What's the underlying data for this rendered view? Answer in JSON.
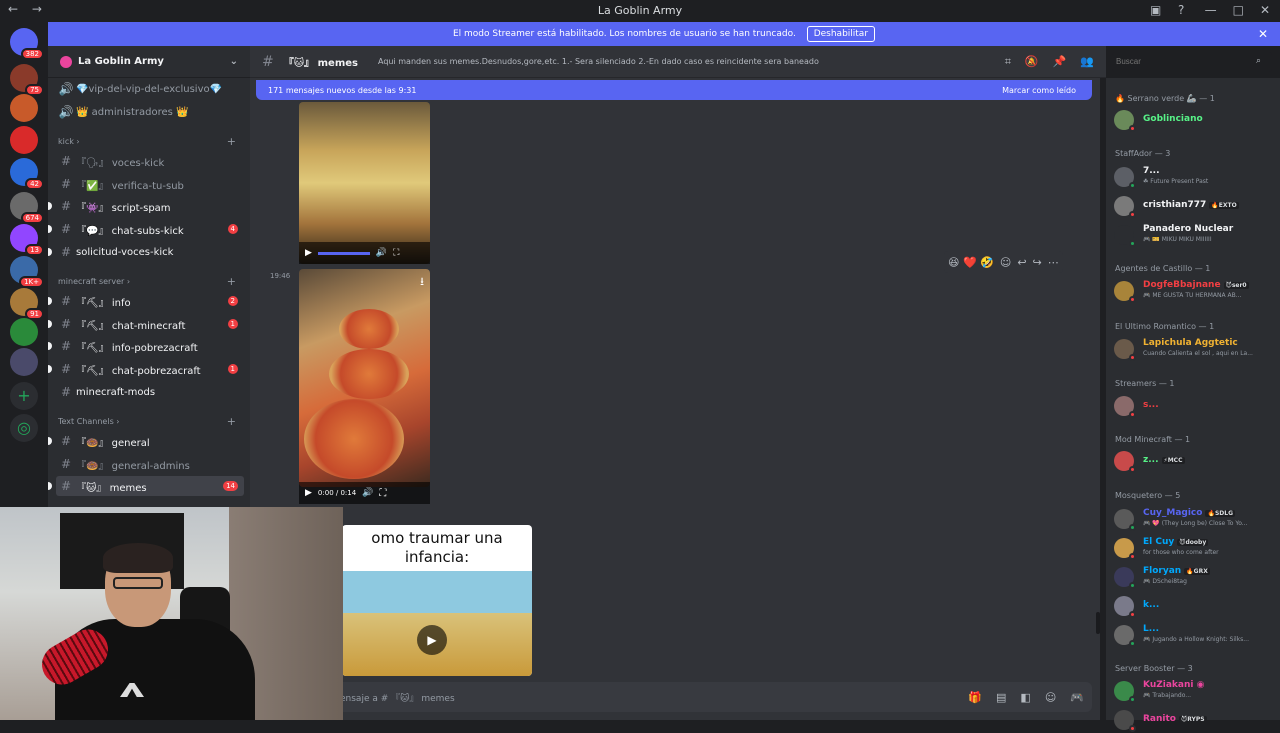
{
  "window": {
    "title": "La Goblin Army"
  },
  "notice": {
    "text": "El modo Streamer está habilitado. Los nombres de usuario se han truncado.",
    "button": "Deshabilitar"
  },
  "servers": [
    {
      "badge": "382"
    },
    {
      "badge": "75"
    },
    {
      "badge": ""
    },
    {
      "badge": ""
    },
    {
      "badge": "42"
    },
    {
      "badge": "674"
    },
    {
      "badge": "13"
    },
    {
      "badge": "1K+"
    },
    {
      "badge": "91"
    },
    {
      "badge": ""
    },
    {
      "badge": ""
    }
  ],
  "guild": {
    "name": "La Goblin Army"
  },
  "channels": {
    "top": [
      {
        "name": "💎vip-del-vip-del-exclusivo💎"
      },
      {
        "name": "👑 administradores 👑"
      }
    ],
    "cat_kick": "kick",
    "kick": [
      {
        "name": "『🗣』 voces-kick",
        "count": ""
      },
      {
        "name": "『✅』 verifica-tu-sub",
        "count": ""
      },
      {
        "name": "『👾』 script-spam",
        "count": ""
      },
      {
        "name": "『💬』 chat-subs-kick",
        "count": "4"
      },
      {
        "name": "solicitud-voces-kick",
        "count": ""
      }
    ],
    "cat_mc": "minecraft server",
    "mc": [
      {
        "name": "『⛏』 info",
        "count": "2"
      },
      {
        "name": "『⛏』 chat-minecraft",
        "count": "1"
      },
      {
        "name": "『⛏』 info-pobrezacraft",
        "count": ""
      },
      {
        "name": "『⛏』 chat-pobrezacraft",
        "count": "1"
      },
      {
        "name": "minecraft-mods",
        "count": ""
      }
    ],
    "cat_text": "Text Channels",
    "text": [
      {
        "name": "『🍩』 general",
        "count": ""
      },
      {
        "name": "『🍩』 general-admins",
        "count": ""
      },
      {
        "name": "『🐱』 memes",
        "count": "14"
      }
    ]
  },
  "header": {
    "channel": "『🐱』 memes",
    "topic": "Aqui manden sus memes.Desnudos,gore,etc. 1.- Sera silenciado 2.-En dado caso es reincidente sera baneado",
    "search_placeholder": "Buscar"
  },
  "newbar": {
    "text": "171 mensajes nuevos desde las 9:31",
    "mark": "Marcar como leído"
  },
  "messages": {
    "time": "19:46",
    "video_time": "0:00 / 0:14",
    "meme_caption": "omo traumar una infancia:",
    "reactions": "😆 ❤️ 🤣"
  },
  "composer": {
    "placeholder": "ensaje a # 『🐱』 memes"
  },
  "members": {
    "groups": [
      {
        "label": "🔥 Serrano verde 🦾 — 1"
      },
      {
        "label": "StaffAdor — 3"
      },
      {
        "label": "Agentes de Castillo — 1"
      },
      {
        "label": "El Ultimo Romantico — 1"
      },
      {
        "label": "Streamers — 1"
      },
      {
        "label": "Mod Minecraft — 1"
      },
      {
        "label": "Mosquetero — 5"
      },
      {
        "label": "Server Booster — 3"
      }
    ],
    "list": [
      {
        "name": "Goblinciano",
        "tag": "",
        "sub": "",
        "color": "#57f287"
      },
      {
        "name": "7...",
        "tag": "",
        "sub": "☘ Future Present Past",
        "color": "#f2f3f5"
      },
      {
        "name": "cristhian777",
        "tag": "🔥EXTO",
        "sub": "",
        "color": "#f2f3f5"
      },
      {
        "name": "Panadero Nuclear",
        "tag": "",
        "sub": "🎮 🎫 MIKU MIKU MIIIIII",
        "color": "#f2f3f5"
      },
      {
        "name": "DogfeBbajnane",
        "tag": "😈ser0",
        "sub": "🎮 ME GUSTA TU HERMANA AB...",
        "color": "#f23f43"
      },
      {
        "name": "Lapichula Aggtetic",
        "tag": "",
        "sub": "Cuando Calienta el sol , aqui en La...",
        "color": "#f0b232"
      },
      {
        "name": "s...",
        "tag": "",
        "sub": "",
        "color": "#f23f43"
      },
      {
        "name": "z...",
        "tag": "⚡MCC",
        "sub": "",
        "color": "#57f287"
      },
      {
        "name": "Cuy_Magico",
        "tag": "🔥SDLG",
        "sub": "🎮 💖 (They Long be) Close To Yo...",
        "color": "#5865f2"
      },
      {
        "name": "El Cuy",
        "tag": "😈dooby",
        "sub": "for those who come after",
        "color": "#00a8fc"
      },
      {
        "name": "Floryan",
        "tag": "🔥GRX",
        "sub": "🎮 DSchei8tag",
        "color": "#00a8fc"
      },
      {
        "name": "k...",
        "tag": "",
        "sub": "",
        "color": "#00a8fc"
      },
      {
        "name": "L...",
        "tag": "",
        "sub": "🎮 Jugando a Hollow Knight: Silks...",
        "color": "#00a8fc"
      },
      {
        "name": "KuZiakani ◉",
        "tag": "",
        "sub": "🎮 Trabajando...",
        "color": "#eb459e"
      },
      {
        "name": "Ranito",
        "tag": "😈RYPS",
        "sub": "",
        "color": "#eb459e"
      }
    ]
  }
}
